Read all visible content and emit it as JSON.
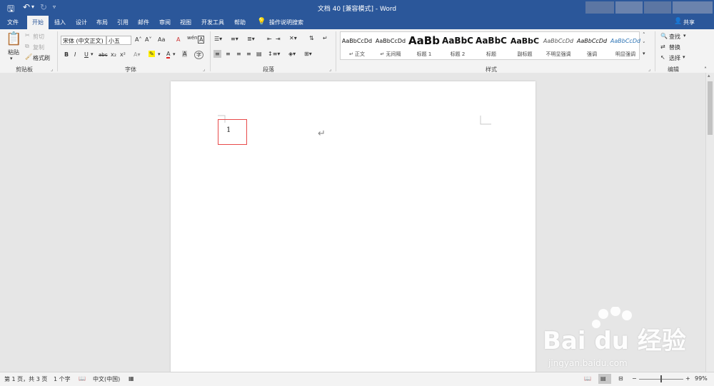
{
  "window": {
    "title": "文档 40 [兼容模式] - Word",
    "share_label": "共享"
  },
  "tabs": [
    "文件",
    "开始",
    "插入",
    "设计",
    "布局",
    "引用",
    "邮件",
    "审阅",
    "视图",
    "开发工具",
    "帮助"
  ],
  "tell_me": "操作说明搜索",
  "clipboard": {
    "paste": "粘贴",
    "cut": "剪切",
    "copy": "复制",
    "format_painter": "格式刷",
    "label": "剪贴板"
  },
  "font": {
    "name": "宋体 (中文正文)",
    "size": "小五",
    "bold": "B",
    "italic": "I",
    "underline": "U",
    "strike": "abc",
    "sub": "x₂",
    "sup": "x²",
    "grow": "A˄",
    "shrink": "A˅",
    "case": "Aa",
    "clear": "A",
    "wen": "wén",
    "label": "字体"
  },
  "paragraph": {
    "label": "段落"
  },
  "styles": {
    "label": "样式",
    "items": [
      {
        "sample": "AaBbCcDd",
        "name": "↵ 正文"
      },
      {
        "sample": "AaBbCcDd",
        "name": "↵ 无间隔"
      },
      {
        "sample": "AaBb",
        "name": "标题 1"
      },
      {
        "sample": "AaBbC",
        "name": "标题 2"
      },
      {
        "sample": "AaBbC",
        "name": "标题"
      },
      {
        "sample": "AaBbC",
        "name": "副标题"
      },
      {
        "sample": "AaBbCcDd",
        "name": "不明显强调"
      },
      {
        "sample": "AaBbCcDd",
        "name": "强调"
      },
      {
        "sample": "AaBbCcDd",
        "name": "明显强调"
      }
    ]
  },
  "editing": {
    "find": "查找",
    "replace": "替换",
    "select": "选择",
    "label": "编辑"
  },
  "document": {
    "page_number": "1",
    "paragraph_mark": "↵"
  },
  "status": {
    "page": "第 1 页，共 3 页",
    "words": "1 个字",
    "language": "中文(中国)",
    "zoom": "99%",
    "zoom_minus": "−",
    "zoom_plus": "+"
  },
  "watermark": {
    "brand": "Bai du 经验",
    "url": "jingyan.baidu.com"
  },
  "colors": {
    "accent": "#2b579a",
    "highlight_box": "#e84a4a",
    "font_color": "#e02020",
    "highlight_color": "#ffee00"
  }
}
